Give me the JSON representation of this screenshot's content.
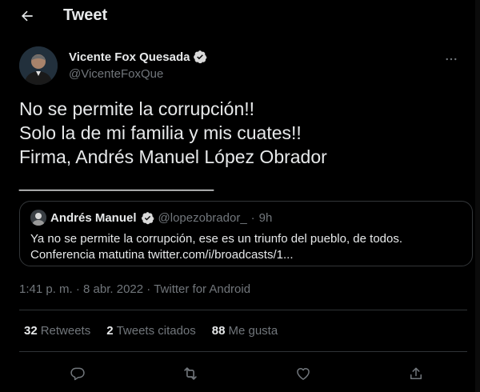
{
  "header": {
    "title": "Tweet",
    "back_icon": "arrow-left-icon"
  },
  "tweet": {
    "author": {
      "name": "Vicente Fox Quesada",
      "handle": "@VicenteFoxQue",
      "verified": true,
      "avatar_icon": "user-avatar"
    },
    "text_lines": [
      "No se permite la corrupción!!",
      "Solo la de mi familia y mis cuates!!",
      "Firma, Andrés Manuel López Obrador",
      "___________________"
    ],
    "quoted": {
      "name": "Andrés Manuel",
      "handle": "@lopezobrador_",
      "separator": "·",
      "time": "9h",
      "verified": true,
      "text_lines": [
        "Ya no se permite la corrupción, ese es un triunfo del pueblo, de todos.",
        "Conferencia matutina twitter.com/i/broadcasts/1..."
      ]
    },
    "meta": {
      "time": "1:41 p. m.",
      "separator1": " · ",
      "date": "8 abr. 2022",
      "separator2": " · ",
      "source": "Twitter for Android"
    },
    "stats": [
      {
        "count": "32",
        "label": "Retweets"
      },
      {
        "count": "2",
        "label": "Tweets citados"
      },
      {
        "count": "88",
        "label": "Me gusta"
      }
    ],
    "actions": [
      "reply-icon",
      "retweet-icon",
      "like-icon",
      "share-icon"
    ]
  },
  "colors": {
    "background": "#000000",
    "text_primary": "#e7e9ea",
    "text_secondary": "#71767b",
    "border": "#2f3336",
    "verified_badge": "#d9d9d9"
  }
}
